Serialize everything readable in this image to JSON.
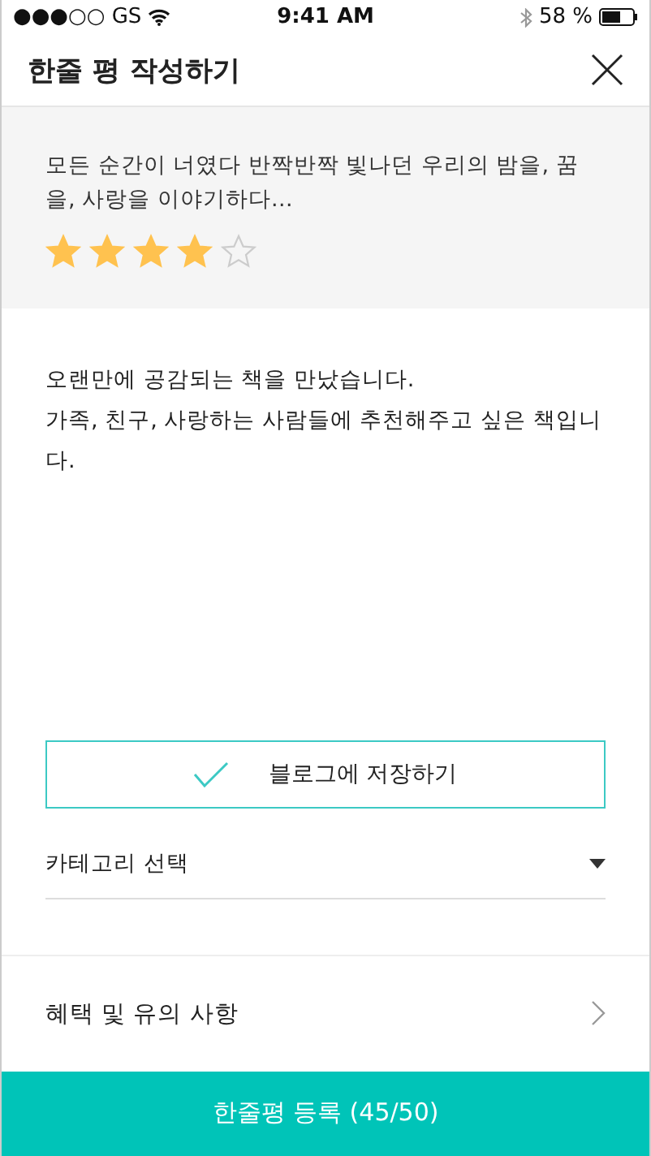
{
  "status_bar": {
    "carrier": "●●●○○ GS",
    "time": "9:41 AM",
    "battery": "58 %"
  },
  "header": {
    "title": "한줄 평 작성하기"
  },
  "book": {
    "description": "모든 순간이 너였다 반짝반짝 빛나던 우리의 밤을, 꿈을, 사랑을 이야기하다…",
    "stars": 4
  },
  "review": {
    "value": "오랜만에 공감되는 책을 만났습니다.\n가족, 친구, 사랑하는 사람들에 추천해주고 싶은 책입니다."
  },
  "blog_save": {
    "label": "블로그에 저장하기",
    "checked": true
  },
  "category": {
    "placeholder": "카테고리 선택"
  },
  "notice": {
    "label": "혜택 및 유의 사항"
  },
  "submit": {
    "label": "한줄평 등록 (45/50)"
  }
}
